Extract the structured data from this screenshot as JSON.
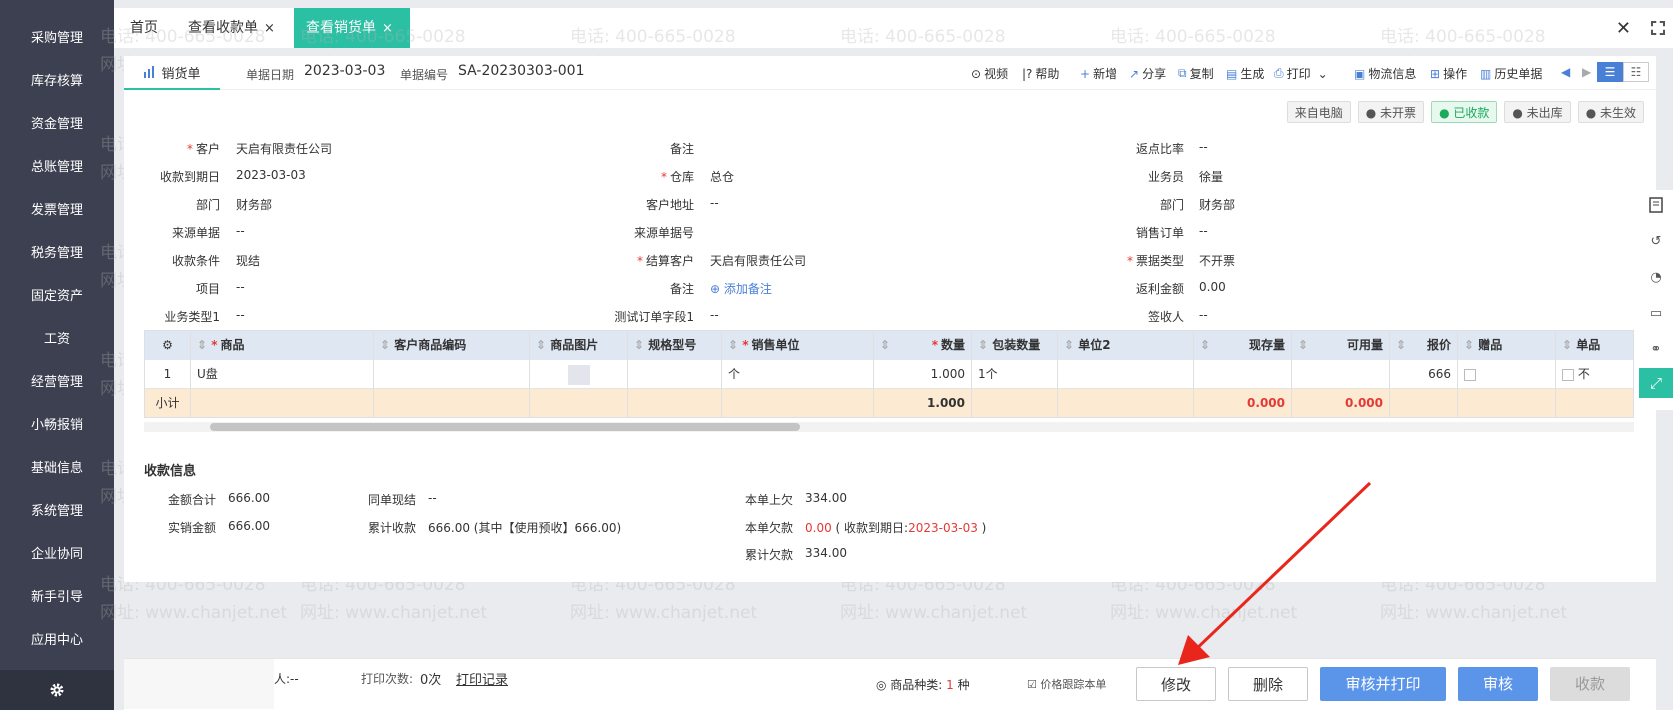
{
  "sidebar": {
    "items": [
      "采购管理",
      "库存核算",
      "资金管理",
      "总账管理",
      "发票管理",
      "税务管理",
      "固定资产",
      "工资",
      "经营管理",
      "小畅报销",
      "基础信息",
      "系统管理",
      "企业协同",
      "新手引导",
      "应用中心"
    ]
  },
  "tabs": [
    {
      "label": "首页"
    },
    {
      "label": "查看收款单"
    },
    {
      "label": "查看销货单"
    }
  ],
  "doc": {
    "title": "销货单",
    "date_label": "单据日期",
    "date": "2023-03-03",
    "code_label": "单据编号",
    "code": "SA-20230303-001"
  },
  "toolbar": {
    "video": "视频",
    "help": "帮助",
    "new": "新增",
    "share": "分享",
    "copy": "复制",
    "generate": "生成",
    "print": "打印",
    "logistics": "物流信息",
    "operate": "操作",
    "history": "历史单据"
  },
  "badges": {
    "source": "来自电脑",
    "invoice": "未开票",
    "paid": "已收款",
    "outbound": "未出库",
    "effective": "未生效"
  },
  "form": {
    "customer_label": "客户",
    "customer": "天启有限责任公司",
    "due_label": "收款到期日",
    "due": "2023-03-03",
    "dept_label": "部门",
    "dept": "财务部",
    "source_doc_label": "来源单据",
    "source_doc": "--",
    "terms_label": "收款条件",
    "terms": "现结",
    "project_label": "项目",
    "project": "--",
    "biztype1_label": "业务类型1",
    "biztype1": "--",
    "remark_label": "备注",
    "remark": "",
    "warehouse_label": "仓库",
    "warehouse": "总仓",
    "address_label": "客户地址",
    "address": "--",
    "source_no_label": "来源单据号",
    "source_no": "",
    "settle_label": "结算客户",
    "settle": "天启有限责任公司",
    "remark2_label": "备注",
    "add_remark": "添加备注",
    "testfield_label": "测试订单字段1",
    "testfield": "--",
    "rebate_ratio_label": "返点比率",
    "rebate_ratio": "--",
    "salesman_label": "业务员",
    "salesman": "徐量",
    "dept2_label": "部门",
    "dept2": "财务部",
    "sales_order_label": "销售订单",
    "sales_order": "--",
    "invoice_type_label": "票据类型",
    "invoice_type": "不开票",
    "rebate_amt_label": "返利金额",
    "rebate_amt": "0.00",
    "signer_label": "签收人",
    "signer": "--"
  },
  "grid": {
    "headers": [
      "商品",
      "客户商品编码",
      "商品图片",
      "规格型号",
      "销售单位",
      "数量",
      "包装数量",
      "单位2",
      "现存量",
      "可用量",
      "报价",
      "赠品",
      "单品"
    ],
    "row": {
      "no": "1",
      "product": "U盘",
      "unit": "个",
      "qty": "1.000",
      "pack": "1个",
      "price": "666",
      "extra": "不"
    },
    "subtotal": {
      "label": "小计",
      "qty": "1.000",
      "stock": "0.000",
      "avail": "0.000"
    }
  },
  "payment": {
    "title": "收款信息",
    "total_label": "金额合计",
    "total": "666.00",
    "actual_label": "实销金额",
    "actual": "666.00",
    "cash_label": "同单现结",
    "cash": "--",
    "cum_label": "累计收款",
    "cum": "666.00 (其中【使用预收】666.00)",
    "prev_label": "本单上欠",
    "prev": "334.00",
    "owe_label": "本单欠款",
    "owe": "0.00",
    "owe_due_prefix": "( 收款到期日:",
    "owe_due": "2023-03-03",
    "owe_due_suffix": ")",
    "cum_owe_label": "累计欠款",
    "cum_owe": "334.00"
  },
  "bottom": {
    "maker_label": "人:--",
    "print_count_label": "打印次数:",
    "print_count": "0次",
    "print_record": "打印记录",
    "kinds_label": "商品种类:",
    "kinds": "1",
    "kinds_unit": "种",
    "price_track": "价格跟踪本单",
    "edit": "修改",
    "delete": "删除",
    "audit_print": "审核并打印",
    "audit": "审核",
    "collect": "收款"
  },
  "watermark": {
    "phone": "电话: 400-665-0028",
    "site": "网址: www.chanjet.net"
  },
  "colors": {
    "accent": "#2bbfa3",
    "primary": "#5b95ea",
    "sidebar": "#3c4050",
    "required": "#e53935",
    "arrow": "#e8261c"
  }
}
